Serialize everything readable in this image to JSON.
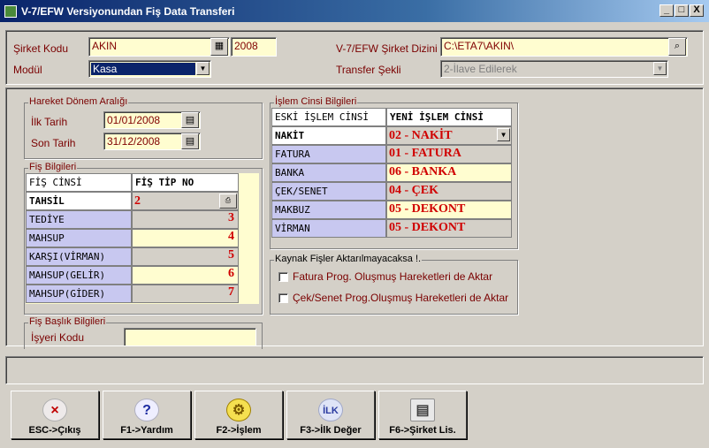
{
  "window": {
    "title": "V-7/EFW Versiyonundan Fiş Data Transferi",
    "minimize": "_",
    "maximize": "□",
    "close": "X"
  },
  "top": {
    "sirket_label": "Şirket Kodu",
    "sirket_value": "AKIN",
    "sirket_year": "2008",
    "modul_label": "Modül",
    "modul_value": "Kasa",
    "dizin_label": "V-7/EFW Şirket Dizini",
    "dizin_value": "C:\\ETA7\\AKIN\\",
    "transfer_label": "Transfer Şekli",
    "transfer_value": "2-İlave Edilerek"
  },
  "donem": {
    "group": "Hareket Dönem Aralığı",
    "ilk_label": "İlk Tarih",
    "ilk_value": "01/01/2008",
    "son_label": "Son Tarih",
    "son_value": "31/12/2008"
  },
  "fis": {
    "group": "Fiş Bilgileri",
    "col1": "FİŞ CİNSİ",
    "col2": "FİŞ TİP NO",
    "rows": [
      {
        "name": "TAHSİL",
        "value": "2"
      },
      {
        "name": "TEDİYE",
        "value": "3"
      },
      {
        "name": "MAHSUP",
        "value": "4"
      },
      {
        "name": "KARŞI(VİRMAN)",
        "value": "5"
      },
      {
        "name": "MAHSUP(GELİR)",
        "value": "6"
      },
      {
        "name": "MAHSUP(GİDER)",
        "value": "7"
      }
    ]
  },
  "baslik": {
    "group": "Fiş Başlık Bilgileri",
    "isyeri_label": "İşyeri Kodu"
  },
  "islem": {
    "group": "İşlem Cinsi Bilgileri",
    "col1": "ESKİ İŞLEM CİNSİ",
    "col2": "YENİ İŞLEM CİNSİ",
    "rows": [
      {
        "old": "NAKİT",
        "new": "02 - NAKİT"
      },
      {
        "old": "FATURA",
        "new": "01 - FATURA"
      },
      {
        "old": "BANKA",
        "new": "06 - BANKA"
      },
      {
        "old": "ÇEK/SENET",
        "new": "04 - ÇEK"
      },
      {
        "old": "MAKBUZ",
        "new": "05 - DEKONT"
      },
      {
        "old": "VİRMAN",
        "new": "05 - DEKONT"
      }
    ]
  },
  "kaynak": {
    "group": "Kaynak Fişler Aktarılmayacaksa  !.",
    "opt1": "Fatura Prog. Oluşmuş Hareketleri de Aktar",
    "opt2": "Çek/Senet Prog.Oluşmuş Hareketleri de Aktar"
  },
  "buttons": [
    {
      "label": "ESC->Çıkış",
      "icon": "×"
    },
    {
      "label": "F1->Yardım",
      "icon": "?"
    },
    {
      "label": "F2->İşlem",
      "icon": "⚙"
    },
    {
      "label": "F3->İlk Değer",
      "icon": "İLK"
    },
    {
      "label": "F6->Şirket Lis.",
      "icon": "▤"
    }
  ],
  "colors": {
    "title_bg": "#0a246a",
    "label": "#7a0000",
    "field_bg": "#fffdd0",
    "value_red": "#d00000",
    "row_header": "#c8c8f0"
  }
}
